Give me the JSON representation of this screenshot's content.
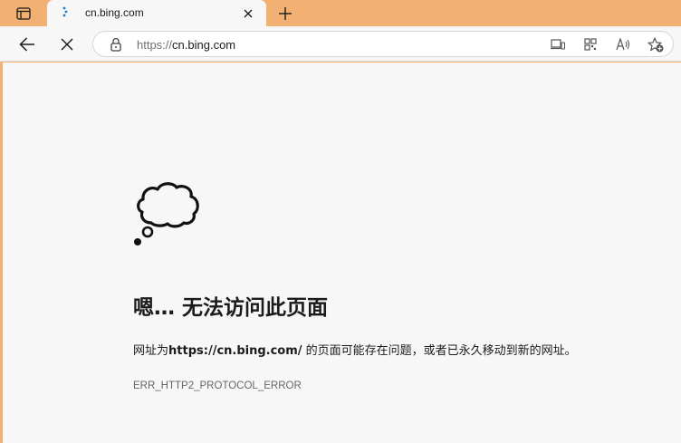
{
  "tab": {
    "title": "cn.bing.com"
  },
  "toolbar": {
    "url_prefix": "https://",
    "url_host": "cn.bing.com"
  },
  "error": {
    "heading": "嗯… 无法访问此页面",
    "message_prefix": "网址为",
    "message_url": "https://cn.bing.com/",
    "message_suffix": " 的页面可能存在问题，或者已永久移动到新的网址。",
    "code": "ERR_HTTP2_PROTOCOL_ERROR"
  },
  "icons": {
    "tab_actions": "tab-actions-icon",
    "favicon": "bing-favicon-icon",
    "close": "close-icon",
    "new_tab": "plus-icon",
    "back": "back-arrow-icon",
    "stop": "stop-icon",
    "lock": "lock-icon",
    "device": "send-to-device-icon",
    "apps": "apps-icon",
    "read_aloud": "read-aloud-icon",
    "favorite": "add-favorite-icon"
  },
  "colors": {
    "frame": "#f3b073",
    "tab_bg": "#f7f7f7",
    "bing_blue": "#1a7fd4"
  }
}
